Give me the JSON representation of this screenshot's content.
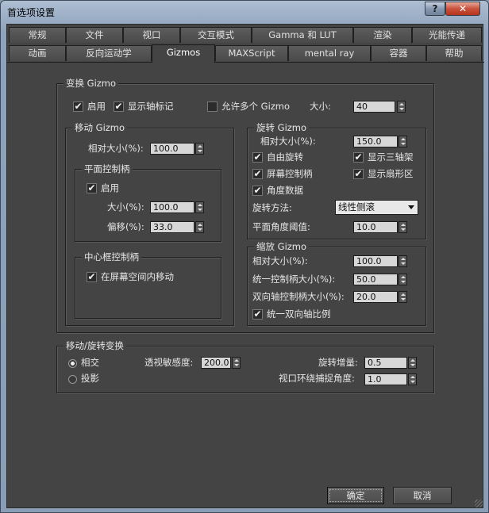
{
  "window": {
    "title": "首选项设置",
    "help_label": "?",
    "close_label": "✕"
  },
  "tabs_row1": [
    "常规",
    "文件",
    "视口",
    "交互模式",
    "Gamma 和 LUT",
    "渲染",
    "光能传递"
  ],
  "tabs_row2": [
    "动画",
    "反向运动学",
    "Gizmos",
    "MAXScript",
    "mental ray",
    "容器",
    "帮助"
  ],
  "active_tab": "Gizmos",
  "transform_gizmo": {
    "title": "变换 Gizmo",
    "enable": {
      "label": "启用",
      "checked": true
    },
    "show_axis": {
      "label": "显示轴标记",
      "checked": true
    },
    "allow_multiple": {
      "label": "允许多个 Gizmo",
      "checked": false
    },
    "size_label": "大小:",
    "size_value": "40"
  },
  "move_gizmo": {
    "title": "移动 Gizmo",
    "rel_size_label": "相对大小(%):",
    "rel_size_value": "100.0",
    "plane_handle": {
      "title": "平面控制柄",
      "enable": {
        "label": "启用",
        "checked": true
      },
      "size_label": "大小(%):",
      "size_value": "100.0",
      "offset_label": "偏移(%):",
      "offset_value": "33.0"
    },
    "center_box": {
      "title": "中心框控制柄",
      "move_screen": {
        "label": "在屏幕空间内移动",
        "checked": true
      }
    }
  },
  "rotate_gizmo": {
    "title": "旋转 Gizmo",
    "rel_size_label": "相对大小(%):",
    "rel_size_value": "150.0",
    "free_rotate": {
      "label": "自由旋转",
      "checked": true
    },
    "show_tripod": {
      "label": "显示三轴架",
      "checked": true
    },
    "screen_handle": {
      "label": "屏幕控制柄",
      "checked": true
    },
    "show_pie": {
      "label": "显示扇形区",
      "checked": true
    },
    "angle_data": {
      "label": "角度数据",
      "checked": true
    },
    "method_label": "旋转方法:",
    "method_value": "线性侧滚",
    "plane_angle_label": "平面角度阈值:",
    "plane_angle_value": "10.0"
  },
  "scale_gizmo": {
    "title": "缩放 Gizmo",
    "rel_size_label": "相对大小(%):",
    "rel_size_value": "100.0",
    "uniform_label": "统一控制柄大小(%):",
    "uniform_value": "50.0",
    "dual_axis_label": "双向轴控制柄大小(%):",
    "dual_axis_value": "20.0",
    "uniform_dual": {
      "label": "统一双向轴比例",
      "checked": true
    }
  },
  "move_rotate_transform": {
    "title": "移动/旋转变换",
    "intersect": {
      "label": "相交",
      "selected": true
    },
    "project": {
      "label": "投影",
      "selected": false
    },
    "perspective_label": "透视敏感度:",
    "perspective_value": "200.0",
    "rotate_inc_label": "旋转增量:",
    "rotate_inc_value": "0.5",
    "orbit_snap_label": "视口环绕捕捉角度:",
    "orbit_snap_value": "1.0"
  },
  "buttons": {
    "ok": "确定",
    "cancel": "取消"
  },
  "check_glyph": "✔"
}
